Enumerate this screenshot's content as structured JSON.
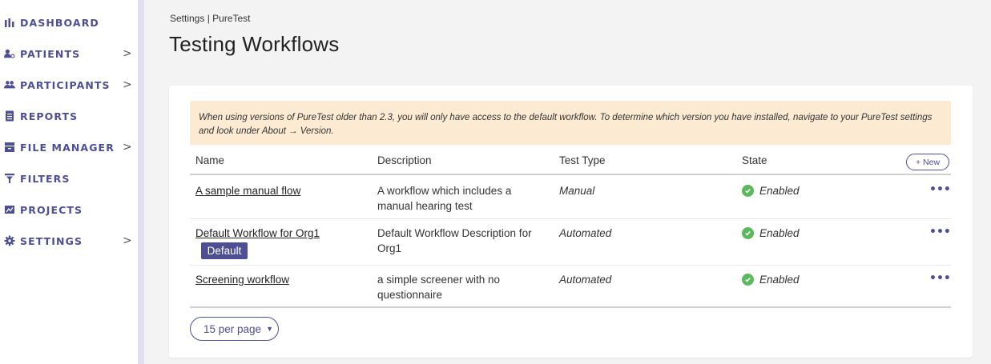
{
  "sidebar": {
    "items": [
      {
        "label": "DASHBOARD",
        "icon": "bar-chart-icon",
        "has_chevron": false
      },
      {
        "label": "PATIENTS",
        "icon": "patient-icon",
        "has_chevron": true
      },
      {
        "label": "PARTICIPANTS",
        "icon": "participants-icon",
        "has_chevron": true
      },
      {
        "label": "REPORTS",
        "icon": "report-icon",
        "has_chevron": false
      },
      {
        "label": "FILE MANAGER",
        "icon": "file-manager-icon",
        "has_chevron": true
      },
      {
        "label": "FILTERS",
        "icon": "filter-icon",
        "has_chevron": false
      },
      {
        "label": "PROJECTS",
        "icon": "projects-icon",
        "has_chevron": false
      },
      {
        "label": "SETTINGS",
        "icon": "gear-icon",
        "has_chevron": true
      }
    ],
    "chevron": ">"
  },
  "breadcrumb": "Settings | PureTest",
  "page_title": "Testing Workflows",
  "notice": "When using versions of PureTest older than 2.3, you will only have access to the default workflow. To determine which version you have installed, navigate to your PureTest settings and look under About → Version.",
  "table": {
    "headers": {
      "name": "Name",
      "description": "Description",
      "test_type": "Test Type",
      "state": "State"
    },
    "new_button": "+ New",
    "rows": [
      {
        "name": "A sample manual flow",
        "description": "A workflow which includes a manual hearing test",
        "test_type": "Manual",
        "state": "Enabled",
        "badge": ""
      },
      {
        "name": "Default Workflow for Org1",
        "description": "Default Workflow Description for Org1",
        "test_type": "Automated",
        "state": "Enabled",
        "badge": "Default"
      },
      {
        "name": "Screening workflow",
        "description": "a simple screener with no questionnaire",
        "test_type": "Automated",
        "state": "Enabled",
        "badge": ""
      }
    ],
    "more_label": "•••"
  },
  "pagination": {
    "per_page": "15 per page",
    "caret": "▼"
  },
  "colors": {
    "accent": "#4d4f94",
    "notice_bg": "#fcebd2",
    "enabled": "#5cb85c",
    "sidebar_stripe": "#e1dff0"
  }
}
